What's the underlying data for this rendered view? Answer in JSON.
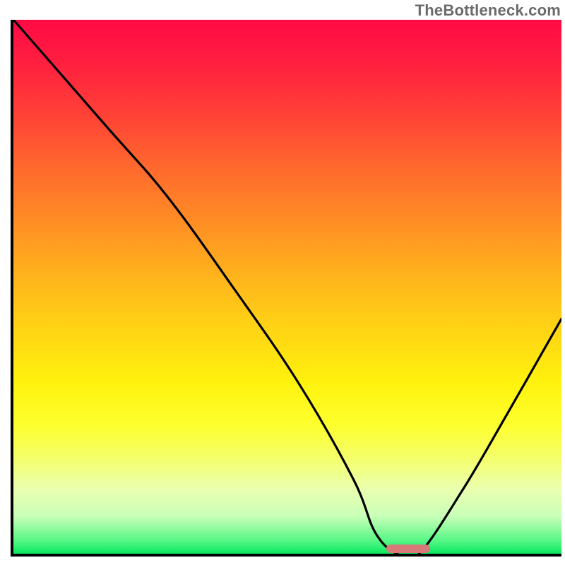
{
  "watermark": "TheBottleneck.com",
  "chart_data": {
    "type": "line",
    "title": "",
    "xlabel": "",
    "ylabel": "",
    "xlim": [
      0,
      100
    ],
    "ylim": [
      0,
      100
    ],
    "grid": false,
    "legend": false,
    "series": [
      {
        "name": "bottleneck-curve",
        "x": [
          0,
          17,
          28,
          40,
          52,
          62,
          66,
          70,
          74,
          82,
          90,
          100
        ],
        "values": [
          100,
          80,
          67,
          50,
          32,
          14,
          4,
          0,
          0,
          12,
          26,
          44
        ]
      }
    ],
    "annotations": [
      {
        "name": "optimal-marker",
        "x_range": [
          68,
          76
        ],
        "y": 0,
        "color": "#d87a7a"
      }
    ],
    "background": {
      "type": "vertical-heat-gradient",
      "stops": [
        {
          "pos": 0.0,
          "color": "#ff0a45"
        },
        {
          "pos": 0.5,
          "color": "#ffb31c"
        },
        {
          "pos": 0.75,
          "color": "#fdff2e"
        },
        {
          "pos": 0.97,
          "color": "#58f786"
        },
        {
          "pos": 1.0,
          "color": "#09e85e"
        }
      ]
    }
  }
}
